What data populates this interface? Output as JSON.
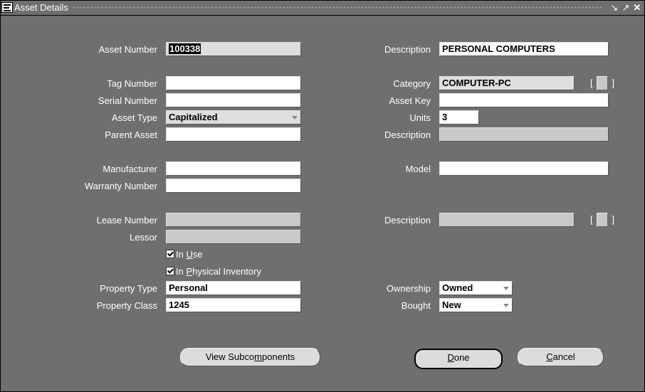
{
  "window": {
    "title": "Asset Details",
    "icon": "app-icon",
    "controls": [
      "minimize-icon",
      "maximize-icon",
      "close-icon"
    ]
  },
  "left": {
    "asset_number": {
      "label": "Asset Number",
      "value": "100338"
    },
    "tag_number": {
      "label": "Tag Number",
      "value": ""
    },
    "serial_number": {
      "label": "Serial Number",
      "value": ""
    },
    "asset_type": {
      "label": "Asset Type",
      "value": "Capitalized"
    },
    "parent_asset": {
      "label": "Parent Asset",
      "value": ""
    },
    "manufacturer": {
      "label": "Manufacturer",
      "value": ""
    },
    "warranty_number": {
      "label": "Warranty Number",
      "value": ""
    },
    "lease_number": {
      "label": "Lease Number",
      "value": ""
    },
    "lessor": {
      "label": "Lessor",
      "value": ""
    },
    "in_use": {
      "pre": "In ",
      "mnemonic": "U",
      "post": "se",
      "checked": true
    },
    "in_physical_inventory": {
      "pre": "In ",
      "mnemonic": "P",
      "post": "hysical Inventory",
      "checked": true
    },
    "property_type": {
      "label": "Property Type",
      "value": "Personal"
    },
    "property_class": {
      "label": "Property Class",
      "value": "1245"
    }
  },
  "right": {
    "description": {
      "label": "Description",
      "value": "PERSONAL COMPUTERS"
    },
    "category": {
      "label": "Category",
      "value": "COMPUTER-PC"
    },
    "asset_key": {
      "label": "Asset Key",
      "value": ""
    },
    "units": {
      "label": "Units",
      "value": "3"
    },
    "parent_description": {
      "label": "Description",
      "value": ""
    },
    "model": {
      "label": "Model",
      "value": ""
    },
    "lease_description": {
      "label": "Description",
      "value": ""
    },
    "ownership": {
      "label": "Ownership",
      "value": "Owned"
    },
    "bought": {
      "label": "Bought",
      "value": "New"
    }
  },
  "lov": {
    "open": "[",
    "close": "]"
  },
  "buttons": {
    "view_subcomponents": {
      "pre": "View Subco",
      "mnemonic": "m",
      "post": "ponents"
    },
    "done": {
      "pre": "",
      "mnemonic": "D",
      "post": "one"
    },
    "cancel": {
      "pre": "",
      "mnemonic": "C",
      "post": "ancel"
    }
  }
}
